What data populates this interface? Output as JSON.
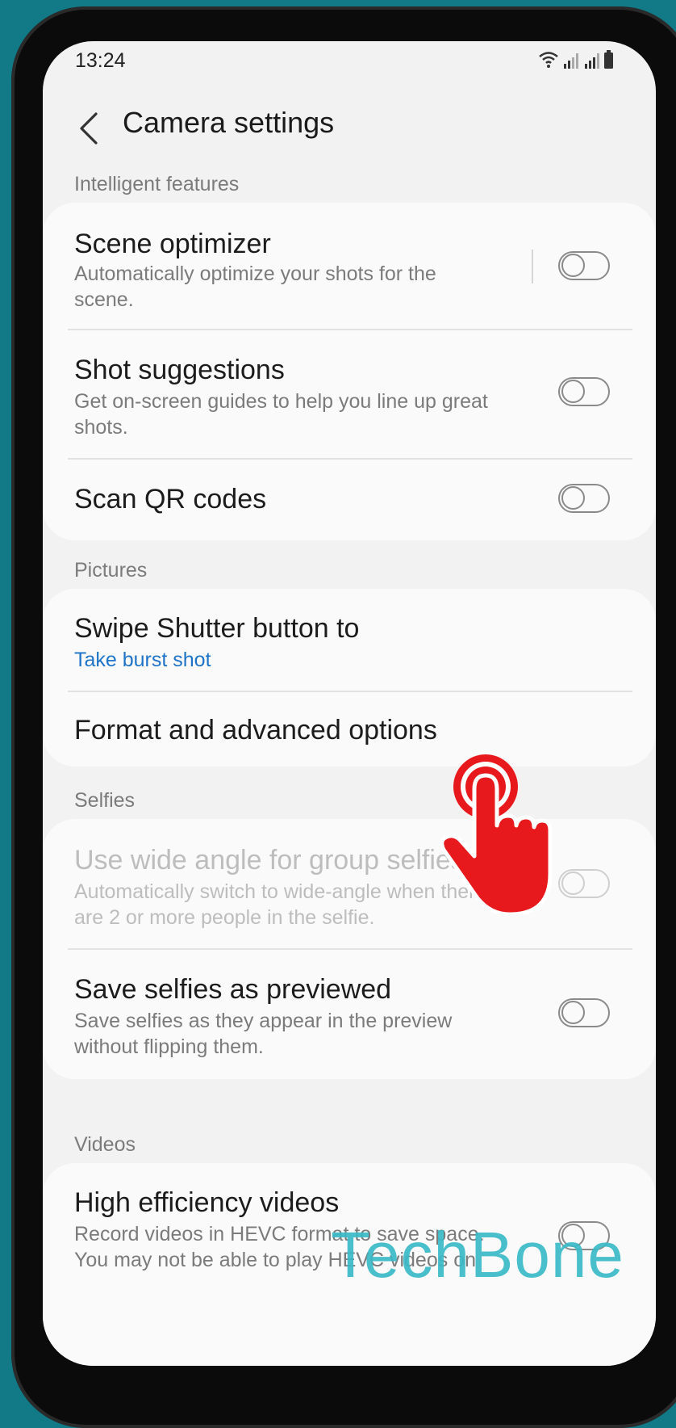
{
  "status_bar": {
    "time": "13:24",
    "icons": [
      "wifi-icon",
      "signal-icon",
      "signal-icon",
      "battery-icon"
    ]
  },
  "header": {
    "title": "Camera settings"
  },
  "sections": [
    {
      "label": "Intelligent features",
      "items": [
        {
          "title": "Scene optimizer",
          "subtitle": "Automatically optimize your shots for the scene.",
          "toggle": "off"
        },
        {
          "title": "Shot suggestions",
          "subtitle": "Get on-screen guides to help you line up great shots.",
          "toggle": "off"
        },
        {
          "title": "Scan QR codes",
          "toggle": "off"
        }
      ]
    },
    {
      "label": "Pictures",
      "items": [
        {
          "title": "Swipe Shutter button to",
          "value": "Take burst shot"
        },
        {
          "title": "Format and advanced options"
        }
      ]
    },
    {
      "label": "Selfies",
      "items": [
        {
          "title": "Use wide angle for group selfies",
          "subtitle": "Automatically switch to wide-angle when there are 2 or more people in the selfie.",
          "toggle": "off",
          "disabled": true
        },
        {
          "title": "Save selfies as previewed",
          "subtitle": "Save selfies as they appear in the preview without flipping them.",
          "toggle": "off"
        }
      ]
    },
    {
      "label": "Videos",
      "items": [
        {
          "title": "High efficiency videos",
          "subtitle": "Record videos in HEVC format to save space. You may not be able to play HEVC videos on",
          "toggle": "off"
        }
      ]
    }
  ],
  "overlay": {
    "pointer": "tap-hand-icon",
    "watermark": "TechBone"
  },
  "colors": {
    "background": "#127a87",
    "accent_link": "#1f74c8",
    "tap_hand": "#e8191d",
    "watermark": "#3bbac8"
  }
}
